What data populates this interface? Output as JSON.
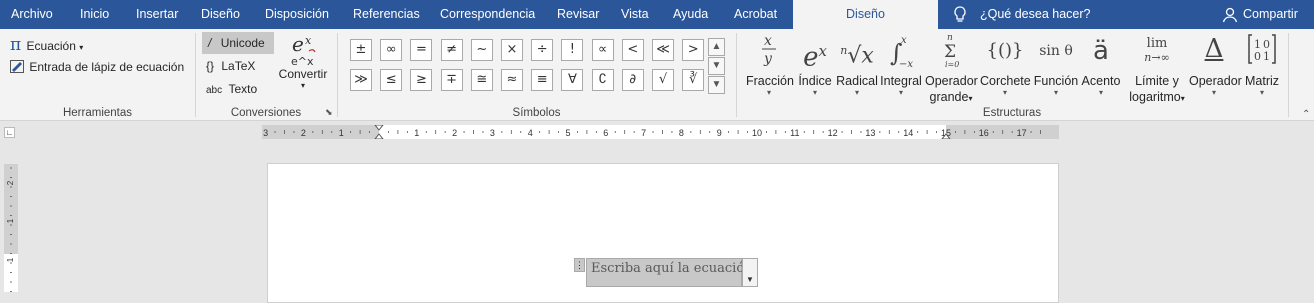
{
  "tabs": {
    "archivo": "Archivo",
    "inicio": "Inicio",
    "insertar": "Insertar",
    "diseno": "Diseño",
    "disposicion": "Disposición",
    "referencias": "Referencias",
    "correspondencia": "Correspondencia",
    "revisar": "Revisar",
    "vista": "Vista",
    "ayuda": "Ayuda",
    "acrobat": "Acrobat",
    "diseno_active": "Diseño",
    "search": "¿Qué desea hacer?",
    "share": "Compartir"
  },
  "herramientas": {
    "ecuacion": "Ecuación",
    "ecuacion_icon": "π",
    "lapiz": "Entrada de lápiz de ecuación",
    "label": "Herramientas"
  },
  "conversiones": {
    "unicode_icon": "/",
    "unicode": "Unicode",
    "latex_icon": "{}",
    "latex": "LaTeX",
    "texto_icon": "abc",
    "texto": "Texto",
    "convertir": "Convertir",
    "label": "Conversiones"
  },
  "simbolos": {
    "label": "Símbolos",
    "row1": [
      "±",
      "∞",
      "=",
      "≠",
      "~",
      "×",
      "÷",
      "!",
      "∝",
      "<",
      "≪",
      ">"
    ],
    "row2": [
      "≫",
      "≤",
      "≥",
      "∓",
      "≅",
      "≈",
      "≡",
      "∀",
      "∁",
      "∂",
      "√",
      "∛"
    ]
  },
  "estructuras": {
    "label": "Estructuras",
    "fraccion": "Fracción",
    "indice": "Índice",
    "radical": "Radical",
    "integral": "Integral",
    "operador_grande_1": "Operador",
    "operador_grande_2": "grande",
    "corchete": "Corchete",
    "funcion": "Función",
    "acento": "Acento",
    "limite_1": "Límite y",
    "limite_2": "logaritmo",
    "operador": "Operador",
    "matriz": "Matriz",
    "glyph_funcion": "sin θ",
    "glyph_acento": "ä",
    "glyph_corchete": "{()}",
    "glyph_operador": "Δ",
    "glyph_limite_top": "lim",
    "glyph_limite_bot": "n→∞"
  },
  "ruler": {
    "numbers": [
      "3",
      "2",
      "1",
      "1",
      "2",
      "3",
      "4",
      "5",
      "6",
      "7",
      "8",
      "9",
      "10",
      "11",
      "12",
      "13",
      "14",
      "15",
      "16",
      "17"
    ],
    "vnumbers": [
      "2",
      "1",
      "1"
    ]
  },
  "document": {
    "placeholder": "Escriba aquí la ecuación."
  },
  "colors": {
    "accent": "#2b579a"
  }
}
